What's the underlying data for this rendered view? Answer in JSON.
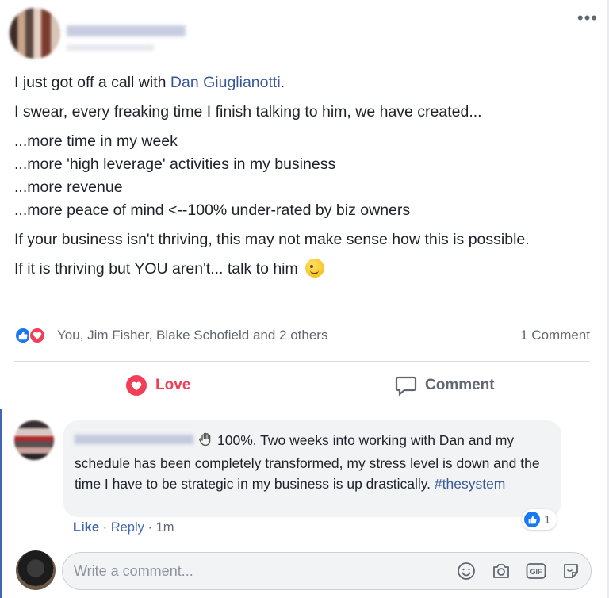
{
  "post": {
    "paragraph_1_prefix": "I just got off a call with ",
    "mention": "Dan Giuglianotti",
    "paragraph_1_suffix": ".",
    "paragraph_2": "I swear, every freaking time I finish talking to him, we have created...",
    "list": [
      "...more time in my week",
      "...more 'high leverage' activities in my business",
      "...more revenue",
      "...more peace of mind <--100% under-rated by biz owners"
    ],
    "paragraph_3": "If your business isn't thriving, this may not make sense how this is possible.",
    "paragraph_4": "If it is thriving but YOU aren't... talk to him"
  },
  "reactions": {
    "summary": "You, Jim Fisher, Blake Schofield and 2 others",
    "comment_count": "1 Comment"
  },
  "actions": {
    "love_label": "Love",
    "comment_label": "Comment"
  },
  "comment": {
    "text": "100%. Two weeks into working with Dan and my schedule has been completely transformed, my stress level is down and the time I have to be strategic in my business is up drastically. ",
    "hashtag": "#thesystem",
    "like_label": "Like",
    "separator": " · ",
    "reply_label": "Reply",
    "time": "1m",
    "like_count": "1"
  },
  "compose": {
    "placeholder": "Write a comment...",
    "icons": [
      "emoji-icon",
      "camera-icon",
      "gif-icon",
      "sticker-icon"
    ]
  },
  "colors": {
    "link": "#385898",
    "love": "#f33e58",
    "like": "#1877f2"
  }
}
